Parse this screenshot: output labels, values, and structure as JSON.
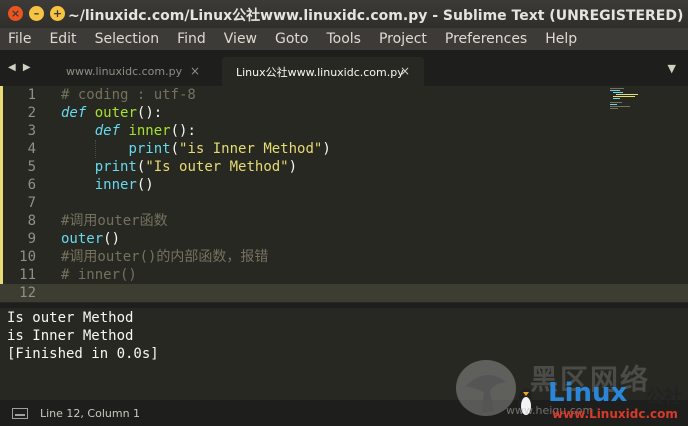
{
  "window": {
    "title": "~/linuxidc.com/Linux公社www.linuxidc.com.py - Sublime Text (UNREGISTERED)",
    "controls": {
      "close": "×",
      "minimize": "–",
      "maximize": "+"
    }
  },
  "menu": [
    "File",
    "Edit",
    "Selection",
    "Find",
    "View",
    "Goto",
    "Tools",
    "Project",
    "Preferences",
    "Help"
  ],
  "tabs": [
    {
      "label": "www.linuxidc.com.py",
      "close": "×",
      "active": false
    },
    {
      "label": "Linux公社www.linuxidc.com.py",
      "close": "×",
      "active": true
    }
  ],
  "tab_nav": {
    "arrows": "◀ ▶",
    "dropdown": "▼"
  },
  "editor": {
    "line_numbers": [
      "1",
      "2",
      "3",
      "4",
      "5",
      "6",
      "7",
      "8",
      "9",
      "10",
      "11",
      "12"
    ],
    "lines": [
      [
        {
          "t": "# coding : utf-8",
          "c": "cm"
        }
      ],
      [
        {
          "t": "def",
          "c": "kw"
        },
        {
          "t": " ",
          "c": "wht"
        },
        {
          "t": "outer",
          "c": "fn"
        },
        {
          "t": "():",
          "c": "wht"
        }
      ],
      [
        {
          "t": "    ",
          "c": "wht"
        },
        {
          "t": "def",
          "c": "kw"
        },
        {
          "t": " ",
          "c": "wht"
        },
        {
          "t": "inner",
          "c": "fn"
        },
        {
          "t": "():",
          "c": "wht"
        }
      ],
      [
        {
          "t": "        ",
          "c": "wht"
        },
        {
          "t": "print",
          "c": "bi"
        },
        {
          "t": "(",
          "c": "wht"
        },
        {
          "t": "\"is Inner Method\"",
          "c": "str"
        },
        {
          "t": ")",
          "c": "wht"
        }
      ],
      [
        {
          "t": "    ",
          "c": "wht"
        },
        {
          "t": "print",
          "c": "bi"
        },
        {
          "t": "(",
          "c": "wht"
        },
        {
          "t": "\"Is outer Method\"",
          "c": "str"
        },
        {
          "t": ")",
          "c": "wht"
        }
      ],
      [
        {
          "t": "    ",
          "c": "wht"
        },
        {
          "t": "inner",
          "c": "bi"
        },
        {
          "t": "()",
          "c": "wht"
        }
      ],
      [],
      [
        {
          "t": "#调用outer函数",
          "c": "cm"
        }
      ],
      [
        {
          "t": "outer",
          "c": "bi"
        },
        {
          "t": "()",
          "c": "wht"
        }
      ],
      [
        {
          "t": "#调用outer()的内部函数，报错",
          "c": "cm"
        }
      ],
      [
        {
          "t": "# inner()",
          "c": "cm"
        }
      ],
      []
    ]
  },
  "output": [
    "Is outer Method",
    "is Inner Method",
    "[Finished in 0.0s]"
  ],
  "status": {
    "position": "Line 12, Column 1"
  },
  "watermark": {
    "brand": "Linux",
    "brand_cn": "公社",
    "url": "www.Linuxidc.com",
    "faint_text": "黑区网络",
    "faint_url": "www.heiqu.com"
  },
  "colors": {
    "background": "#272822",
    "keyword": "#66d9ef",
    "function": "#a6e22e",
    "string": "#e6db74",
    "comment": "#75715e",
    "close_button": "#e95420"
  }
}
